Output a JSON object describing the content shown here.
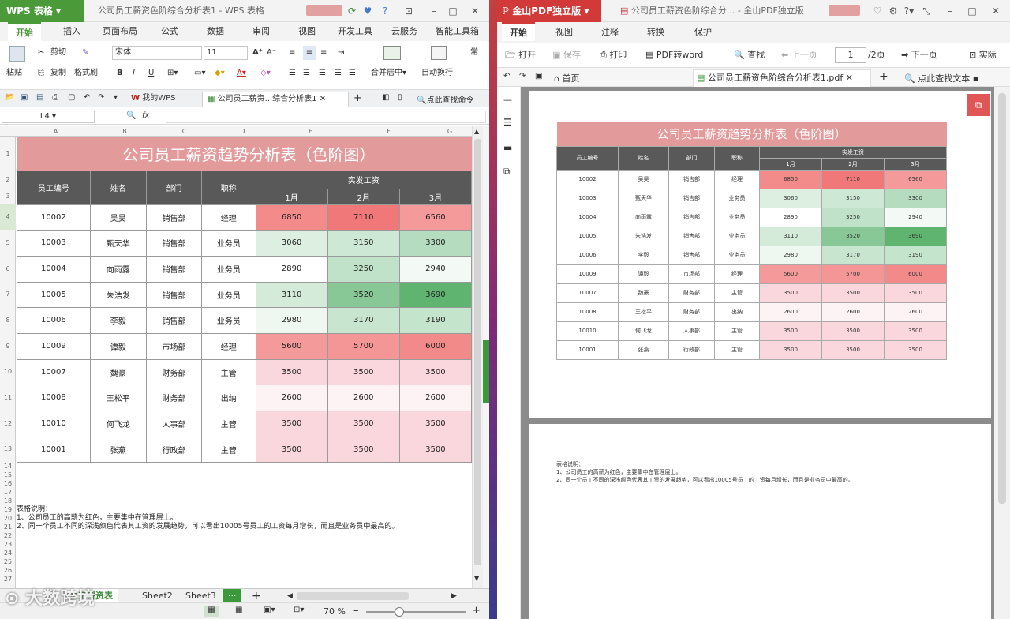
{
  "wps": {
    "app_name": "WPS 表格",
    "doc_title": "公司员工薪资色阶综合分析表1 - WPS 表格",
    "menu": [
      "开始",
      "插入",
      "页面布局",
      "公式",
      "数据",
      "审阅",
      "视图",
      "开发工具",
      "云服务",
      "智能工具箱"
    ],
    "ribbon": {
      "paste": "粘贴",
      "cut": "剪切",
      "copy": "复制",
      "format_painter": "格式刷",
      "font": "宋体",
      "font_size": "11",
      "merge_center": "合并居中",
      "wrap": "自动换行",
      "regular": "常"
    },
    "tabs": {
      "mywps": "我的WPS",
      "doc": "公司员工薪资...综合分析表1",
      "search": "点此查找命令"
    },
    "name_box": "L4",
    "fx": "fx",
    "columns": [
      "A",
      "B",
      "C",
      "D",
      "E",
      "F",
      "G"
    ],
    "rows": [
      "1",
      "2",
      "3",
      "4",
      "5",
      "6",
      "7",
      "8",
      "9",
      "10",
      "11",
      "12",
      "13",
      "14",
      "15",
      "16",
      "17",
      "18",
      "19",
      "20",
      "21",
      "22",
      "23",
      "24",
      "25",
      "26",
      "27"
    ],
    "sheet_tabs": [
      "员工薪资表",
      "Sheet2",
      "Sheet3"
    ],
    "zoom": "70 %"
  },
  "table": {
    "title": "公司员工薪资趋势分析表（色阶图）",
    "headers": [
      "员工编号",
      "姓名",
      "部门",
      "职称"
    ],
    "group_header": "实发工资",
    "months": [
      "1月",
      "2月",
      "3月"
    ],
    "rows": [
      {
        "id": "10002",
        "name": "吴昊",
        "dept": "销售部",
        "title": "经理",
        "v": [
          "6850",
          "7110",
          "6560"
        ],
        "c": [
          "#f48b8b",
          "#f07878",
          "#f59a9a"
        ]
      },
      {
        "id": "10003",
        "name": "甄天华",
        "dept": "销售部",
        "title": "业务员",
        "v": [
          "3060",
          "3150",
          "3300"
        ],
        "c": [
          "#dcefe1",
          "#cde8d4",
          "#b5dcbf"
        ]
      },
      {
        "id": "10004",
        "name": "向雨露",
        "dept": "销售部",
        "title": "业务员",
        "v": [
          "2890",
          "3250",
          "2940"
        ],
        "c": [
          "#ffffff",
          "#bfe2c8",
          "#f3f9f4"
        ]
      },
      {
        "id": "10005",
        "name": "朱浩发",
        "dept": "销售部",
        "title": "业务员",
        "v": [
          "3110",
          "3520",
          "3690"
        ],
        "c": [
          "#d5ebda",
          "#88c896",
          "#5fb56f"
        ]
      },
      {
        "id": "10006",
        "name": "李毅",
        "dept": "销售部",
        "title": "业务员",
        "v": [
          "2980",
          "3170",
          "3190"
        ],
        "c": [
          "#eef7f0",
          "#c8e6cf",
          "#c4e4cb"
        ]
      },
      {
        "id": "10009",
        "name": "谭毅",
        "dept": "市场部",
        "title": "经理",
        "v": [
          "5600",
          "5700",
          "6000"
        ],
        "c": [
          "#f49a9a",
          "#f49696",
          "#f38a8a"
        ]
      },
      {
        "id": "10007",
        "name": "魏豪",
        "dept": "财务部",
        "title": "主管",
        "v": [
          "3500",
          "3500",
          "3500"
        ],
        "c": [
          "#fad7dc",
          "#fad7dc",
          "#fad7dc"
        ]
      },
      {
        "id": "10008",
        "name": "王松平",
        "dept": "财务部",
        "title": "出纳",
        "v": [
          "2600",
          "2600",
          "2600"
        ],
        "c": [
          "#fdf3f4",
          "#fdf3f4",
          "#fdf3f4"
        ]
      },
      {
        "id": "10010",
        "name": "何飞龙",
        "dept": "人事部",
        "title": "主管",
        "v": [
          "3500",
          "3500",
          "3500"
        ],
        "c": [
          "#fad7dc",
          "#fad7dc",
          "#fad7dc"
        ]
      },
      {
        "id": "10001",
        "name": "张燕",
        "dept": "行政部",
        "title": "主管",
        "v": [
          "3500",
          "3500",
          "3500"
        ],
        "c": [
          "#fad7dc",
          "#fad7dc",
          "#fad7dc"
        ]
      }
    ],
    "notes": [
      "表格说明：",
      "1、公司员工的高薪为红色，主要集中在管理层上。",
      "2、同一个员工不同的深浅颜色代表其工资的发展趋势，可以看出10005号员工的工资每月增长，而且是业务员中最高的。"
    ]
  },
  "pdf": {
    "app_name": "金山PDF独立版",
    "doc_title": "公司员工薪资色阶综合分... - 金山PDF独立版",
    "menu": [
      "开始",
      "视图",
      "注释",
      "转换",
      "保护"
    ],
    "toolbar": {
      "open": "打开",
      "save": "保存",
      "print": "打印",
      "to_word": "PDF转word",
      "find": "查找",
      "prev": "上一页",
      "page": "1",
      "page_total": "/2页",
      "next": "下一页",
      "actual": "实际"
    },
    "tabs": {
      "home": "首页",
      "doc": "公司员工薪资色阶综合分析表1.pdf",
      "search": "点此查找文本"
    }
  },
  "watermark": "大数跨境"
}
